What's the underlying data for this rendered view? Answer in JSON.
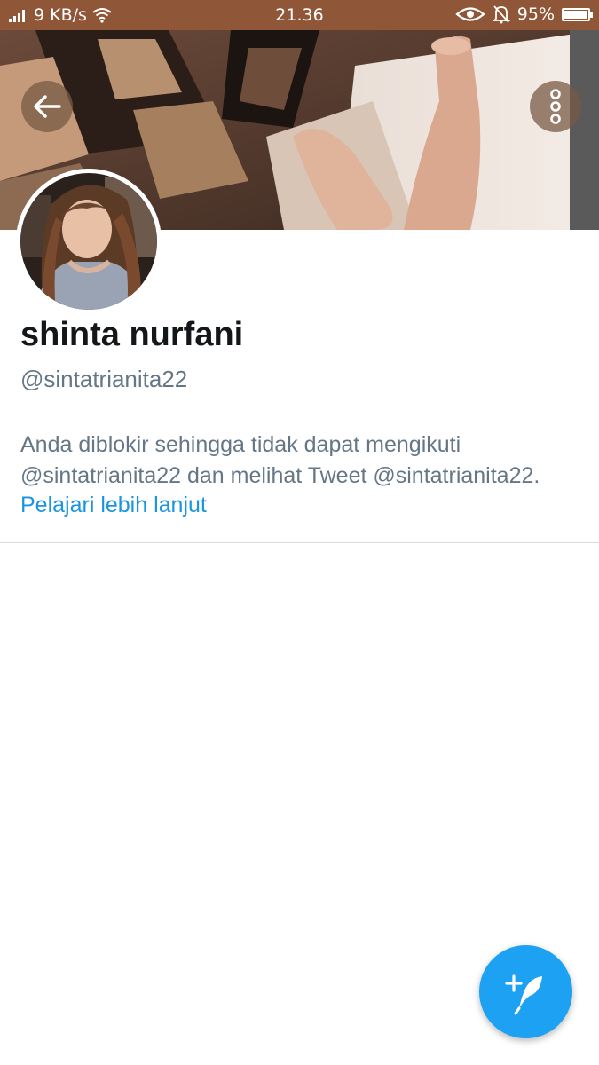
{
  "status_bar": {
    "network_speed": "9 KB/s",
    "time": "21.36",
    "battery_percent": "95%",
    "battery_level": 0.95,
    "background_color": "#8f5637",
    "icons": [
      "signal-icon",
      "wifi-icon",
      "eye-icon",
      "bell-off-icon",
      "battery-icon"
    ]
  },
  "header": {
    "back_icon": "arrow-left-icon",
    "more_icon": "more-vertical-icon"
  },
  "profile": {
    "display_name": "shinta nurfani",
    "handle": "@sintatrianita22"
  },
  "blocked_notice": {
    "message": "Anda diblokir sehingga tidak dapat mengikuti @sintatrianita22 dan melihat Tweet @sintatrianita22.",
    "learn_more_label": "Pelajari lebih lanjut",
    "link_color": "#1b95e0"
  },
  "compose_button": {
    "icon": "compose-tweet-icon",
    "color": "#1da1f2"
  }
}
